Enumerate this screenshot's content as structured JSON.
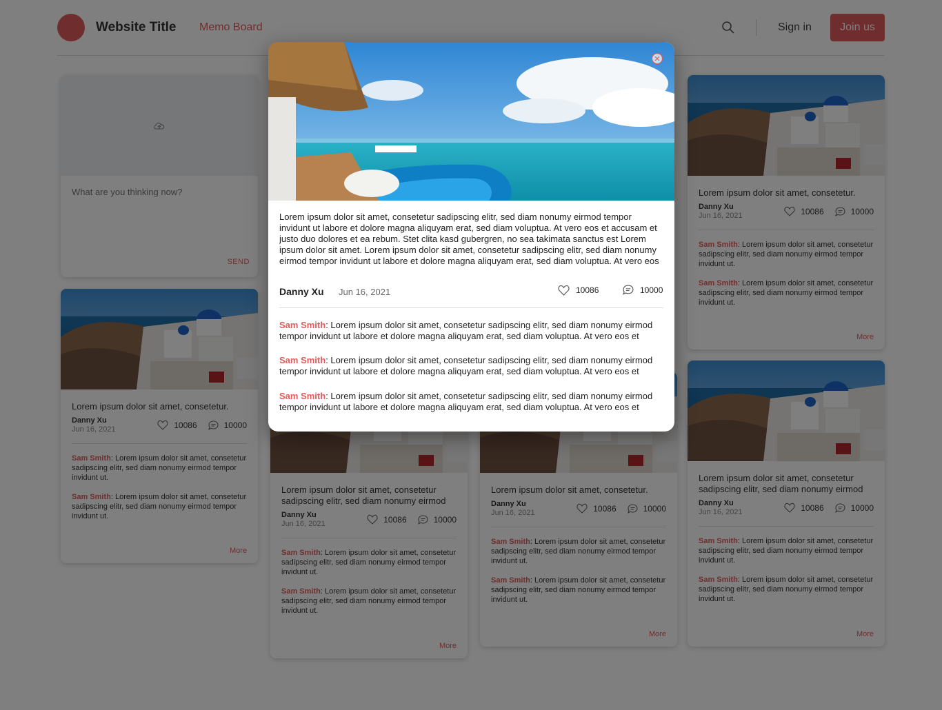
{
  "header": {
    "title": "Website Title",
    "nav_memo": "Memo Board",
    "sign_in": "Sign in",
    "join_us": "Join us",
    "brand_color": "#e15b5b"
  },
  "composer": {
    "placeholder": "What are you thinking now?",
    "send_label": "SEND",
    "upload_icon": "cloud-upload-icon"
  },
  "cards": [
    {
      "title": "Lorem ipsum dolor sit amet, consetetur.",
      "author": "Danny Xu",
      "date": "Jun 16, 2021",
      "likes": "10086",
      "comments_count": "10000",
      "comments": [
        {
          "who": "Sam Smith",
          "text": ": Lorem ipsum dolor sit amet, consetetur sadipscing elitr, sed diam nonumy eirmod tempor invidunt ut."
        },
        {
          "who": "Sam Smith",
          "text": ": Lorem ipsum dolor sit amet, consetetur sadipscing elitr, sed diam nonumy eirmod tempor invidunt ut."
        }
      ],
      "more": "More"
    },
    {
      "title": "Lorem ipsum dolor sit amet, consetetur sadipscing elitr, sed diam nonumy eirmod",
      "author": "Danny Xu",
      "date": "Jun 16, 2021",
      "likes": "10086",
      "comments_count": "10000",
      "comments": [
        {
          "who": "Sam Smith",
          "text": ": Lorem ipsum dolor sit amet, consetetur sadipscing elitr, sed diam nonumy eirmod tempor invidunt ut."
        },
        {
          "who": "Sam Smith",
          "text": ": Lorem ipsum dolor sit amet, consetetur sadipscing elitr, sed diam nonumy eirmod tempor invidunt ut."
        }
      ],
      "more": "More"
    },
    {
      "title": "Lorem ipsum dolor sit amet, consetetur.",
      "author": "Danny Xu",
      "date": "Jun 16, 2021",
      "likes": "10086",
      "comments_count": "10000",
      "comments": [
        {
          "who": "Sam Smith",
          "text": ": Lorem ipsum dolor sit amet, consetetur sadipscing elitr, sed diam nonumy eirmod tempor invidunt ut."
        },
        {
          "who": "Sam Smith",
          "text": ": Lorem ipsum dolor sit amet, consetetur sadipscing elitr, sed diam nonumy eirmod tempor invidunt ut."
        }
      ],
      "more": "More"
    },
    {
      "title": "Lorem ipsum dolor sit amet, consetetur.",
      "author": "Danny Xu",
      "date": "Jun 16, 2021",
      "likes": "10086",
      "comments_count": "10000",
      "comments": [
        {
          "who": "Sam Smith",
          "text": ": Lorem ipsum dolor sit amet, consetetur sadipscing elitr, sed diam nonumy eirmod tempor invidunt ut."
        },
        {
          "who": "Sam Smith",
          "text": ": Lorem ipsum dolor sit amet, consetetur sadipscing elitr, sed diam nonumy eirmod tempor invidunt ut."
        }
      ],
      "more": "More"
    },
    {
      "title": "Lorem ipsum dolor sit amet, consetetur sadipscing elitr, sed diam nonumy eirmod",
      "author": "Danny Xu",
      "date": "Jun 16, 2021",
      "likes": "10086",
      "comments_count": "10000",
      "comments": [
        {
          "who": "Sam Smith",
          "text": ": Lorem ipsum dolor sit amet, consetetur sadipscing elitr, sed diam nonumy eirmod tempor invidunt ut."
        },
        {
          "who": "Sam Smith",
          "text": ": Lorem ipsum dolor sit amet, consetetur sadipscing elitr, sed diam nonumy eirmod tempor invidunt ut."
        }
      ],
      "more": "More"
    }
  ],
  "modal": {
    "text": "Lorem ipsum dolor sit amet, consetetur sadipscing elitr, sed diam nonumy eirmod tempor invidunt ut labore et dolore magna aliquyam erat, sed diam voluptua. At vero eos et accusam et justo duo dolores et ea rebum. Stet clita kasd gubergren, no sea takimata sanctus est Lorem ipsum dolor sit amet. Lorem ipsum dolor sit amet, consetetur sadipscing elitr, sed diam nonumy eirmod tempor invidunt ut labore et dolore magna aliquyam erat, sed diam voluptua. At vero eos",
    "author": "Danny Xu",
    "date": "Jun 16, 2021",
    "likes": "10086",
    "comments_count": "10000",
    "comments": [
      {
        "who": "Sam Smith",
        "text": ": Lorem ipsum dolor sit amet, consetetur sadipscing elitr, sed diam nonumy eirmod tempor invidunt ut labore et dolore magna aliquyam erat, sed diam voluptua. At vero eos et"
      },
      {
        "who": "Sam Smith",
        "text": ": Lorem ipsum dolor sit amet, consetetur sadipscing elitr, sed diam nonumy eirmod tempor invidunt ut labore et dolore magna aliquyam erat, sed diam voluptua. At vero eos et"
      },
      {
        "who": "Sam Smith",
        "text": ": Lorem ipsum dolor sit amet, consetetur sadipscing elitr, sed diam nonumy eirmod tempor invidunt ut labore et dolore magna aliquyam erat, sed diam voluptua. At vero eos et"
      }
    ],
    "close_icon": "close-circle-icon"
  }
}
